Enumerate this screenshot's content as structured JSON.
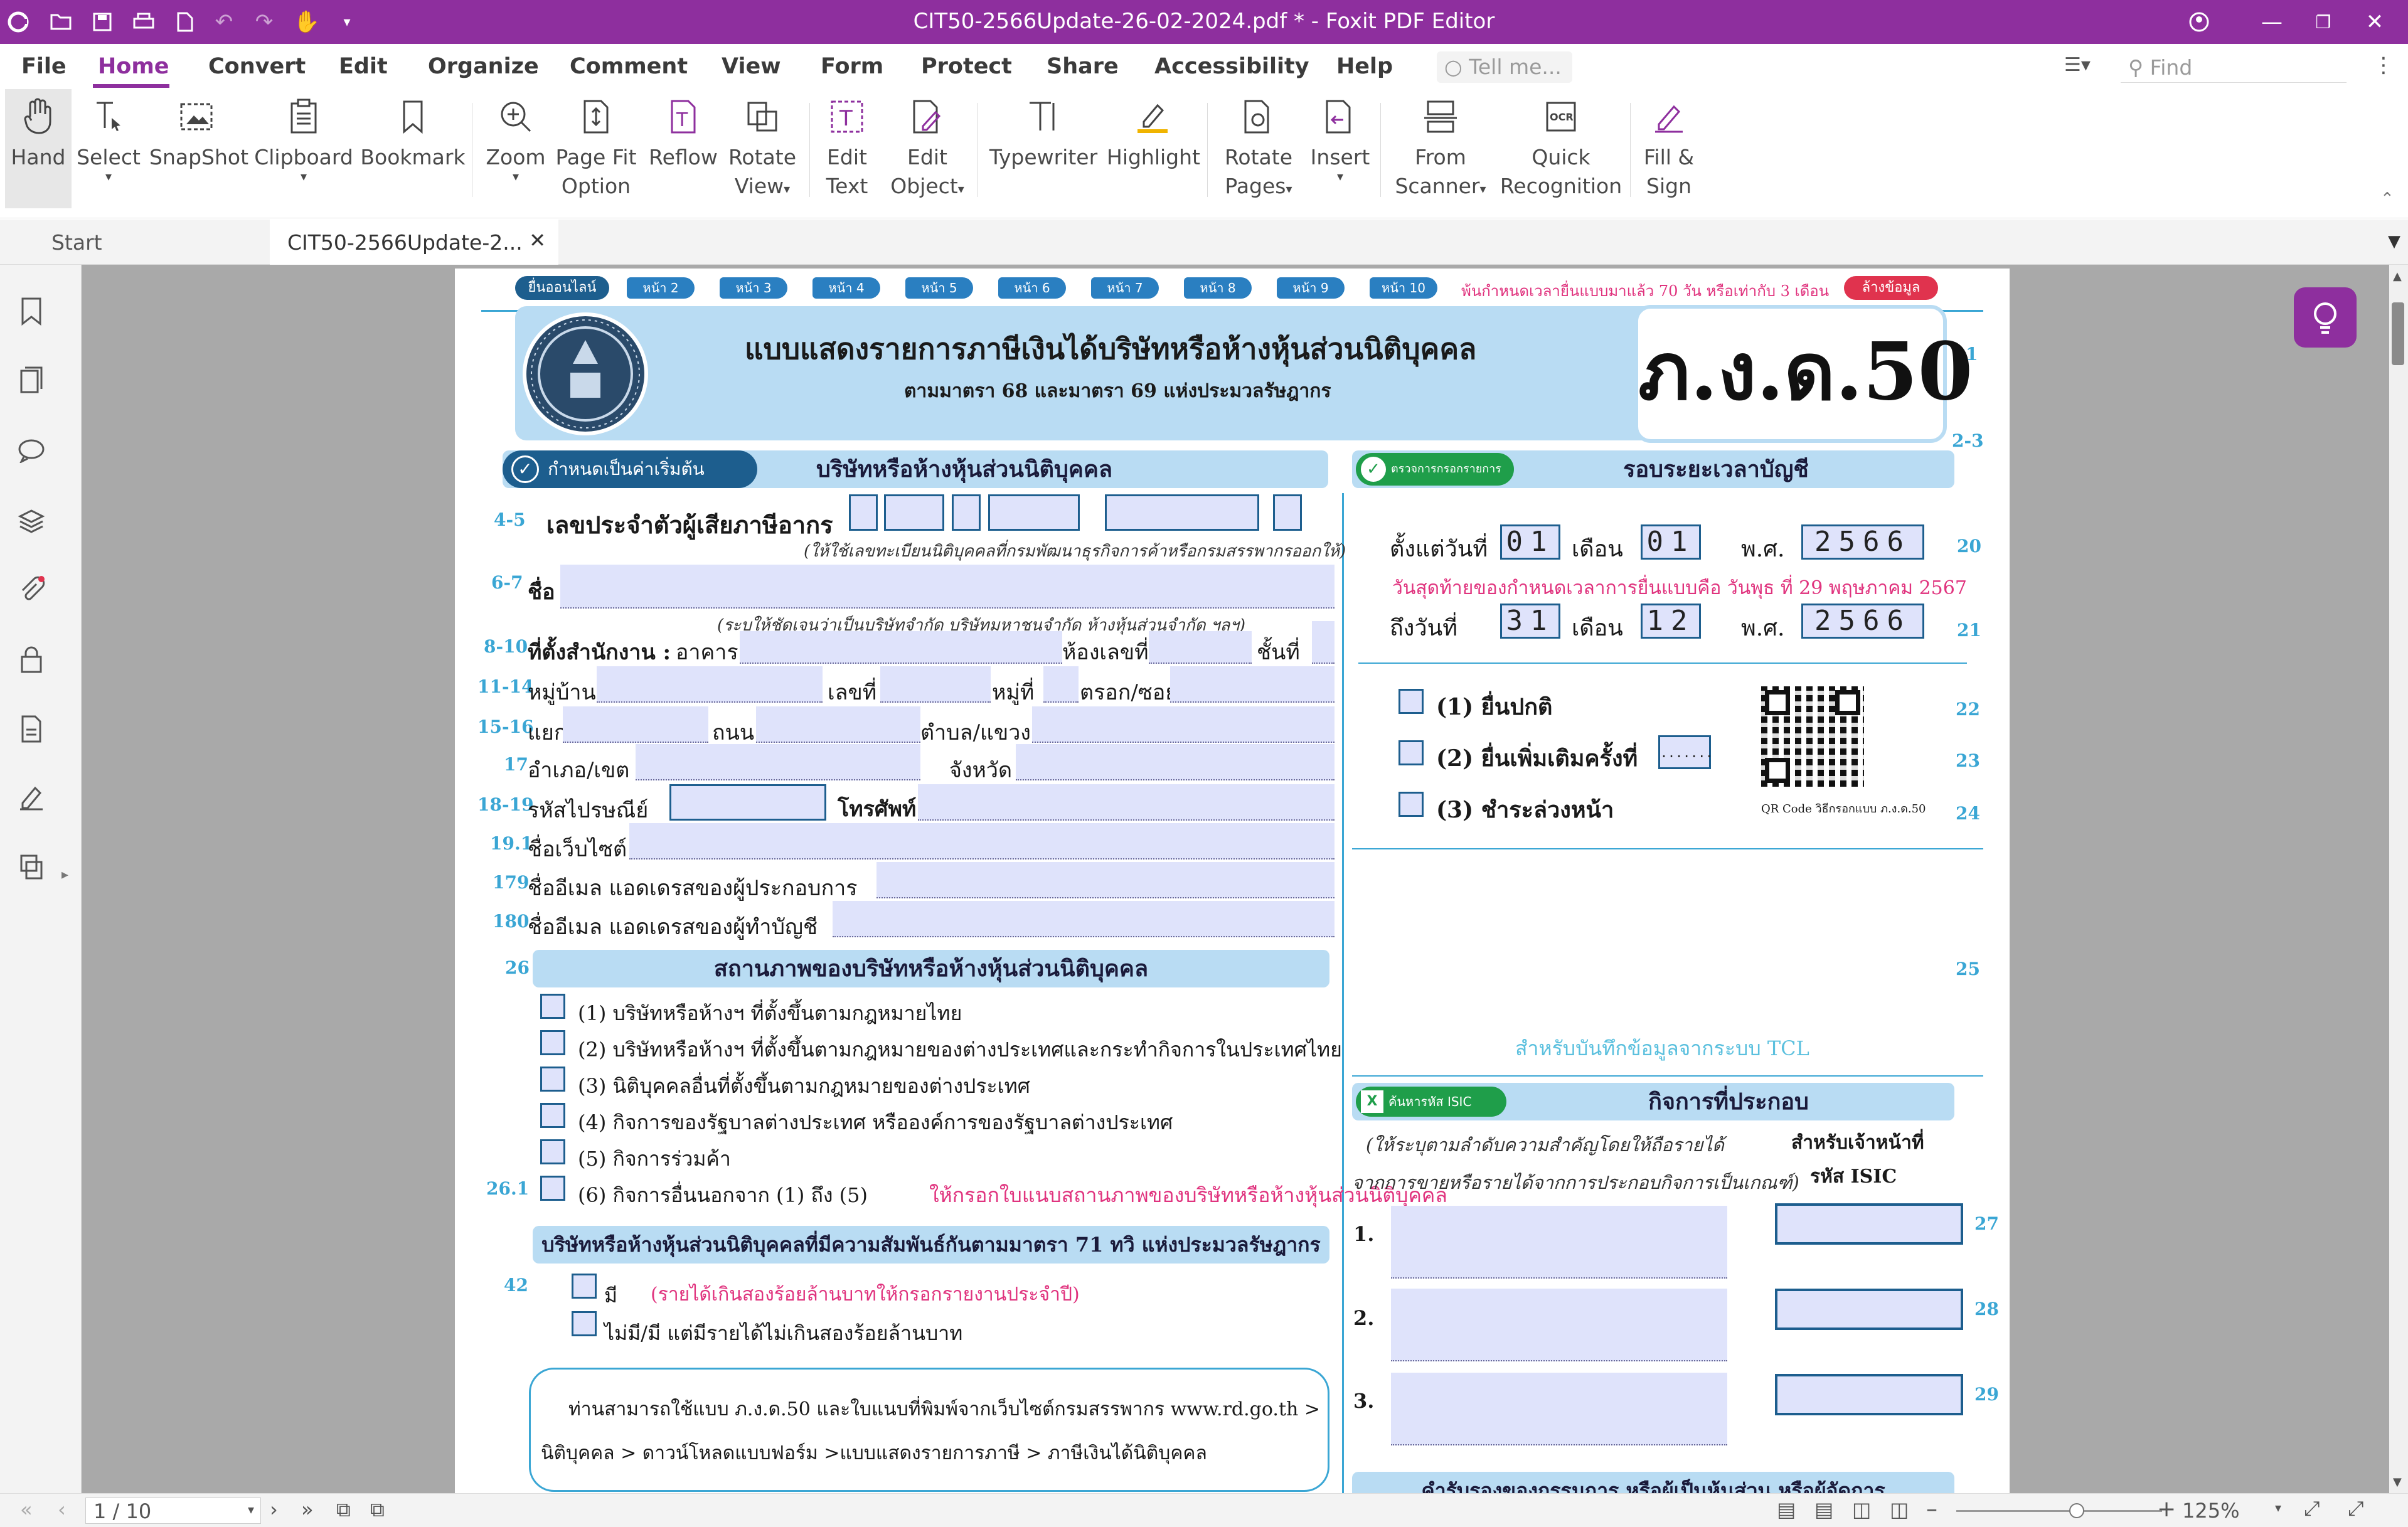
{
  "window": {
    "title": "CIT50-2566Update-26-02-2024.pdf * - Foxit PDF Editor",
    "accent_color": "#8e2f9e"
  },
  "menu": {
    "items": [
      "File",
      "Home",
      "Convert",
      "Edit",
      "Organize",
      "Comment",
      "View",
      "Form",
      "Protect",
      "Share",
      "Accessibility",
      "Help"
    ],
    "active": "Home",
    "tell_me_placeholder": "Tell me...",
    "find_placeholder": "Find"
  },
  "ribbon": {
    "hand": "Hand",
    "select": "Select",
    "snapshot": "SnapShot",
    "clipboard": "Clipboard",
    "bookmark": "Bookmark",
    "zoom": "Zoom",
    "page_fit_1": "Page Fit",
    "page_fit_2": "Option",
    "reflow": "Reflow",
    "rotate_view_1": "Rotate",
    "rotate_view_2": "View",
    "edit_text_1": "Edit",
    "edit_text_2": "Text",
    "edit_object_1": "Edit",
    "edit_object_2": "Object",
    "typewriter": "Typewriter",
    "highlight": "Highlight",
    "rotate_pages_1": "Rotate",
    "rotate_pages_2": "Pages",
    "insert": "Insert",
    "from_scanner_1": "From",
    "from_scanner_2": "Scanner",
    "quick_recog_1": "Quick",
    "quick_recog_2": "Recognition",
    "fill_sign_1": "Fill &",
    "fill_sign_2": "Sign"
  },
  "tabs": {
    "start": "Start",
    "doc": "CIT50-2566Update-2..."
  },
  "status": {
    "page": "1 / 10",
    "zoom": "125%"
  },
  "form": {
    "nav_online": "ยื่นออนไลน์",
    "nav_pages": [
      "หน้า 2",
      "หน้า 3",
      "หน้า 4",
      "หน้า 5",
      "หน้า 6",
      "หน้า 7",
      "หน้า 8",
      "หน้า 9",
      "หน้า 10"
    ],
    "deadline_note": "พ้นกำหนดเวลายื่นแบบมาแล้ว 70 วัน หรือเท่ากับ 3 เดือน",
    "clear_data": "ล้างข้อมูล",
    "main_title": "แบบแสดงรายการภาษีเงินได้บริษัทหรือห้างหุ้นส่วนนิติบุคคล",
    "sub_title": "ตามมาตรา 68 และมาตรา 69 แห่งประมวลรัษฎากร",
    "form_code": "ภ.ง.ด.50",
    "default_btn": "กำหนดเป็นค่าเริ่มต้น",
    "company_header": "บริษัทหรือห้างหุ้นส่วนนิติบุคคล",
    "check_btn": "ตรวจการกรอกรายการ",
    "period_header": "รอบระยะเวลาบัญชี",
    "tax_id_label": "เลขประจำตัวผู้เสียภาษีอากร",
    "tax_id_hint": "(ให้ใช้เลขทะเบียนนิติบุคคลที่กรมพัฒนาธุรกิจการค้าหรือกรมสรรพากรออกให้)",
    "name_label": "ชื่อ",
    "name_hint": "(ระบุให้ชัดเจนว่าเป็นบริษัทจำกัด  บริษัทมหาชนจำกัด  ห้างหุ้นส่วนจำกัด  ฯลฯ)",
    "office_label": "ที่ตั้งสำนักงาน :",
    "building": "อาคาร",
    "room_no": "ห้องเลขที่",
    "floor": "ชั้นที่",
    "village": "หมู่บ้าน",
    "house_no": "เลขที่",
    "moo": "หมู่ที่",
    "soi": "ตรอก/ซอย",
    "junction": "แยก",
    "road": "ถนน",
    "subdistrict": "ตำบล/แขวง",
    "district": "อำเภอ/เขต",
    "province": "จังหวัด",
    "postcode": "รหัสไปรษณีย์",
    "phone": "โทรศัพท์",
    "website": "ชื่อเว็บไซต์",
    "email_operator": "ชื่ออีเมล แอดเดรสของผู้ประกอบการ",
    "email_accountant": "ชื่ออีเมล แอดเดรสของผู้ทำบัญชี",
    "row_nums": {
      "n1": "1",
      "n2_3": "2-3",
      "n4_5": "4-5",
      "n6_7": "6-7",
      "n8_10": "8-10",
      "n11_14": "11-14",
      "n15_16": "15-16",
      "n17": "17",
      "n18_19": "18-19",
      "n19_1": "19.1",
      "n179": "179",
      "n180": "180",
      "n20": "20",
      "n21": "21",
      "n22": "22",
      "n23": "23",
      "n24": "24",
      "n25": "25",
      "n26": "26",
      "n26_1": "26.1",
      "n27": "27",
      "n28": "28",
      "n29": "29",
      "n42": "42"
    },
    "start_date_label": "ตั้งแต่วันที่",
    "start_day": "01",
    "month_label": "เดือน",
    "start_month": "01",
    "year_label": "พ.ศ.",
    "start_year": "2566",
    "deadline_text": "วันสุดท้ายของกำหนดเวลาการยื่นแบบคือ วันพุธ ที่ 29 พฤษภาคม 2567",
    "end_date_label": "ถึงวันที่",
    "end_day": "31",
    "end_month": "12",
    "end_year": "2566",
    "opt1": "(1) ยื่นปกติ",
    "opt2": "(2) ยื่นเพิ่มเติมครั้งที่",
    "opt2_value": ".......",
    "opt3": "(3) ชำระล่วงหน้า",
    "qr_caption": "QR Code วิธีกรอกแบบ ภ.ง.ด.50",
    "tcl_note": "สำหรับบันทึกข้อมูลจากระบบ TCL",
    "status_header": "สถานภาพของบริษัทหรือห้างหุ้นส่วนนิติบุคคล",
    "status_items": [
      "(1)   บริษัทหรือห้างฯ ที่ตั้งขึ้นตามกฎหมายไทย",
      "(2)   บริษัทหรือห้างฯ ที่ตั้งขึ้นตามกฎหมายของต่างประเทศและกระทำกิจการในประเทศไทย",
      "(3)   นิติบุคคลอื่นที่ตั้งขึ้นตามกฎหมายของต่างประเทศ",
      "(4)   กิจการของรัฐบาลต่างประเทศ หรือองค์การของรัฐบาลต่างประเทศ",
      "(5)   กิจการร่วมค้า",
      "(6)   กิจการอื่นนอกจาก (1) ถึง (5)"
    ],
    "status_item6_note": "ให้กรอกใบแนบสถานภาพของบริษัทหรือห้างหุ้นส่วนนิติบุคคล",
    "isic_btn": "ค้นหารหัส ISIC",
    "business_header": "กิจการที่ประกอบ",
    "business_hint_1": "(ให้ระบุตามลำดับความสำคัญโดยให้ถือรายได้",
    "business_hint_2": "จากการขายหรือรายได้จากการประกอบกิจการเป็นเกณฑ์)",
    "officer_1": "สำหรับเจ้าหน้าที่",
    "officer_2": "รหัส ISIC",
    "business_rows": [
      "1.",
      "2.",
      "3."
    ],
    "related_header": "บริษัทหรือห้างหุ้นส่วนนิติบุคคลที่มีความสัมพันธ์กันตามมาตรา 71 ทวิ แห่งประมวลรัษฎากร",
    "related_yes": "มี",
    "related_yes_note": "(รายได้เกินสองร้อยล้านบาทให้กรอกรายงานประจำปี)",
    "related_no": "ไม่มี/มี แต่มีรายได้ไม่เกินสองร้อยล้านบาท",
    "info_box_1": "ท่านสามารถใช้แบบ ภ.ง.ด.50 และใบแนบที่พิมพ์จากเว็บไซต์กรมสรรพากร www.rd.go.th >",
    "info_box_2": "นิติบุคคล > ดาวน์โหลดแบบฟอร์ม >แบบแสดงรายการภาษี > ภาษีเงินได้นิติบุคคล",
    "bottom_cut": "คำรับรองของกรรมการ หรือผู้เป็นหุ้นส่วน หรือผู้จัดการ"
  }
}
